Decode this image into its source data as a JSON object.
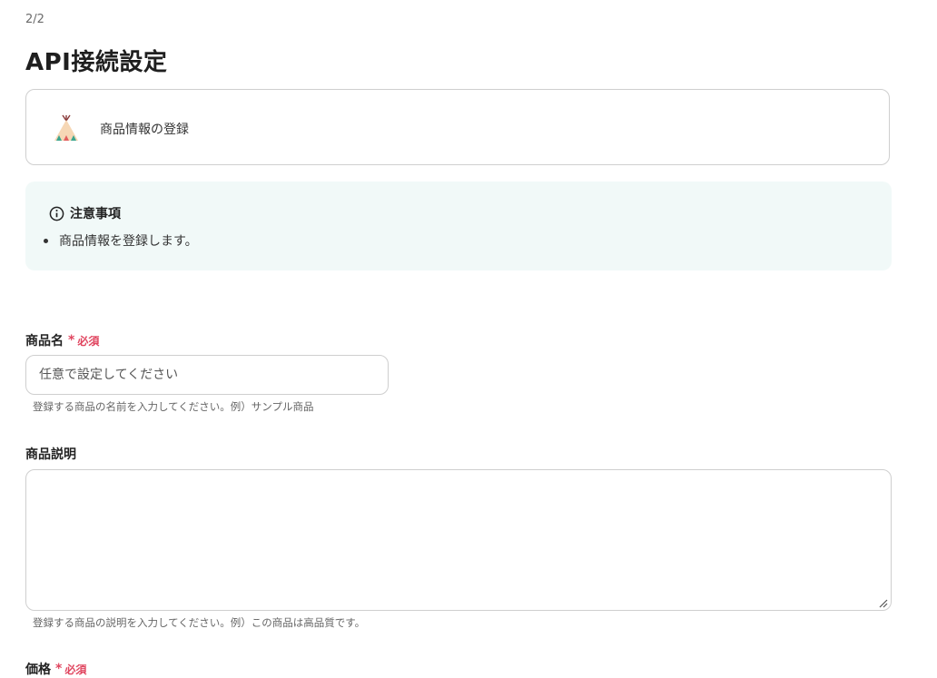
{
  "header": {
    "step": "2/2",
    "title": "API接続設定"
  },
  "app_card": {
    "icon": "teepee-icon",
    "name": "商品情報の登録"
  },
  "notice": {
    "icon": "info-icon",
    "title": "注意事項",
    "items": [
      "商品情報を登録します。"
    ]
  },
  "fields": {
    "product_name": {
      "label": "商品名",
      "required_mark": "*",
      "required_label": "必須",
      "placeholder": "任意で設定してください",
      "hint": "登録する商品の名前を入力してください。例）サンプル商品"
    },
    "product_description": {
      "label": "商品説明",
      "hint": "登録する商品の説明を入力してください。例）この商品は高品質です。"
    },
    "price": {
      "label": "価格",
      "required_mark": "*",
      "required_label": "必須"
    }
  },
  "colors": {
    "required": "#e0455f",
    "notice_bg": "#f1f9f8",
    "border": "#cfcfcf"
  }
}
